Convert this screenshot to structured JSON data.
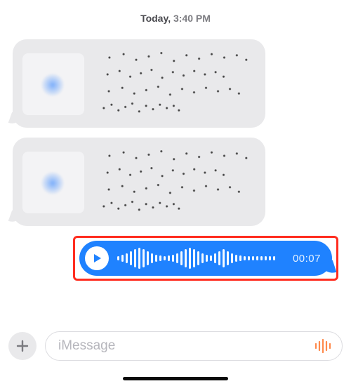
{
  "timestamp": {
    "day": "Today,",
    "time": "3:40 PM"
  },
  "incoming_messages": [
    {
      "kind": "link_preview_redacted"
    },
    {
      "kind": "link_preview_redacted"
    }
  ],
  "audio_message": {
    "duration": "00:07",
    "play_state": "paused",
    "waveform_heights": [
      6,
      10,
      14,
      20,
      26,
      30,
      26,
      20,
      14,
      10,
      8,
      6,
      8,
      10,
      14,
      20,
      26,
      30,
      26,
      20,
      14,
      10,
      8,
      14,
      20,
      26,
      20,
      14,
      10,
      8,
      6,
      6,
      6,
      6,
      6,
      6,
      6,
      6
    ]
  },
  "compose": {
    "placeholder": "iMessage",
    "plus_icon": "plus-icon",
    "audio_icon": "audio-record-icon"
  },
  "colors": {
    "outgoing_bubble": "#1f82ff",
    "incoming_bubble": "#e9e9eb",
    "highlight": "#ff2d1f",
    "audio_icon": "#ff8a4c"
  }
}
